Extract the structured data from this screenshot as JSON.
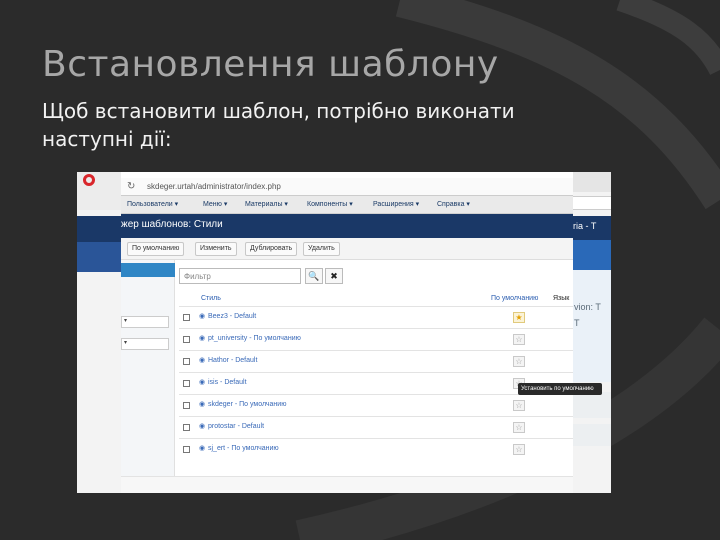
{
  "slide": {
    "title": "Встановлення шаблону",
    "body": "Щоб встановити шаблон, потрібно виконати наступні дії:"
  },
  "browser": {
    "url": "skdeger.urtah/administrator/index.php",
    "back_right_text": "ria - T",
    "back_right_side": [
      "vion: T",
      "T"
    ]
  },
  "menu": [
    "Пользователи ▾",
    "Меню ▾",
    "Материалы ▾",
    "Компоненты ▾",
    "Расширения ▾",
    "Справка ▾"
  ],
  "header": {
    "title": "жер шаблонов: Стили"
  },
  "toolbar": {
    "buttons": [
      "По умолчанию",
      "Изменить",
      "Дублировать",
      "Удалить"
    ]
  },
  "filter": {
    "placeholder": "Фильтр",
    "search_glyph": "🔍",
    "clear_glyph": "✖"
  },
  "columns": {
    "style": "Стиль",
    "default": "По умолчанию",
    "language": "Язык"
  },
  "templates": [
    {
      "name": "Beez3 - Default",
      "default": true
    },
    {
      "name": "pt_university - По умолчанию",
      "default": false
    },
    {
      "name": "Hathor - Default",
      "default": false
    },
    {
      "name": "isis - Default",
      "default": false
    },
    {
      "name": "skdeger - По умолчанию",
      "default": false
    },
    {
      "name": "protostar - Default",
      "default": false
    },
    {
      "name": "sj_ert - По умолчанию",
      "default": false
    }
  ],
  "tooltip": "Установить по умолчанию",
  "colors": {
    "slide_bg": "#2b2b2b",
    "title": "#a7a7a7",
    "header_bar": "#1a3867",
    "accent_blue": "#2f86c5",
    "link": "#3a6ab8"
  }
}
